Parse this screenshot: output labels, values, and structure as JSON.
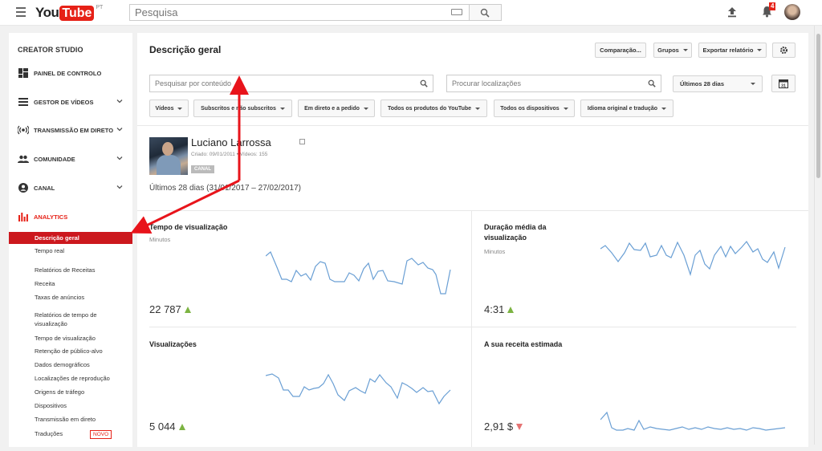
{
  "topbar": {
    "logo_you": "You",
    "logo_tube": "Tube",
    "logo_region": "PT",
    "search_placeholder": "Pesquisa",
    "notification_count": "4"
  },
  "sidebar": {
    "title": "CREATOR STUDIO",
    "nav": [
      {
        "label": "PAINEL DE CONTROLO",
        "icon": "dashboard-icon"
      },
      {
        "label": "GESTOR DE VÍDEOS",
        "icon": "video-manager-icon"
      },
      {
        "label": "TRANSMISSÃO EM DIRETO",
        "icon": "live-icon"
      },
      {
        "label": "COMUNIDADE",
        "icon": "people-icon"
      },
      {
        "label": "CANAL",
        "icon": "account-icon"
      },
      {
        "label": "ANALYTICS",
        "icon": "bar-chart-icon"
      }
    ],
    "sub": [
      "Descrição geral",
      "Tempo real",
      "Relatórios de Receitas",
      "Receita",
      "Taxas de anúncios",
      "Relatórios de tempo de visualização",
      "Tempo de visualização",
      "Retenção de público-alvo",
      "Dados demográficos",
      "Localizações de reprodução",
      "Origens de tráfego",
      "Dispositivos",
      "Transmissão em direto",
      "Traduções"
    ],
    "new_badge": "NOVO"
  },
  "main": {
    "title": "Descrição geral",
    "buttons": {
      "compare": "Comparação...",
      "groups": "Grupos",
      "export": "Exportar relatório"
    },
    "search_content_placeholder": "Pesquisar por conteúdo",
    "search_location_placeholder": "Procurar localizações",
    "period": "Últimos 28 dias",
    "calendar_day": "31",
    "filters": [
      "Vídeos",
      "Subscritos e não subscritos",
      "Em direto e a pedido",
      "Todos os produtos do YouTube",
      "Todos os dispositivos",
      "Idioma original e tradução"
    ],
    "channel": {
      "name": "Luciano Larrossa",
      "meta": "Criado: 09/01/2011  •  Vídeos: 155",
      "badge": "CANAL"
    },
    "date_range": "Últimos 28 dias (31/01/2017 – 27/02/2017)",
    "cards": [
      {
        "title": "Tempo de visualização",
        "sub": "Minutos",
        "value": "22 787",
        "trend": "up"
      },
      {
        "title": "Duração média da visualização",
        "sub": "Minutos",
        "value": "4:31",
        "trend": "up"
      },
      {
        "title": "Visualizações",
        "sub": "",
        "value": "5 044",
        "trend": "up"
      },
      {
        "title": "A sua receita estimada",
        "sub": "",
        "value": "2,91 $",
        "trend": "down"
      }
    ]
  },
  "colors": {
    "brand_red": "#e62117",
    "sparkline": "#6a9fd4",
    "trend_up": "#7cb342",
    "trend_down": "#e57373",
    "annotation_arrow": "#e8141b"
  }
}
